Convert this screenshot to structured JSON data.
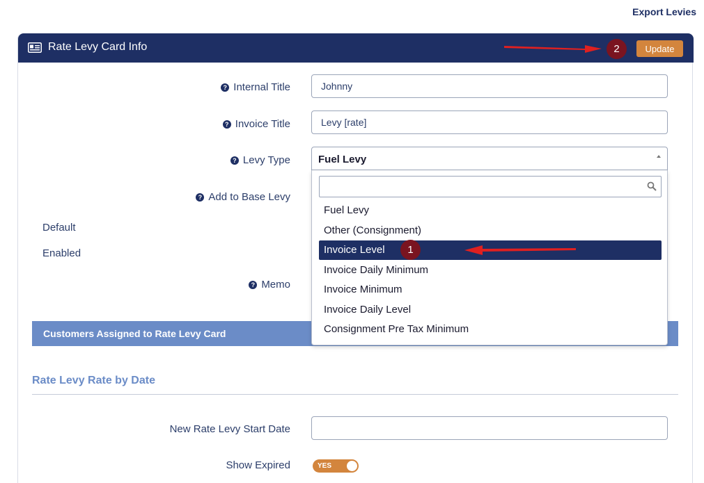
{
  "header": {
    "export_link": "Export Levies"
  },
  "card": {
    "title": "Rate Levy Card Info",
    "update_label": "Update"
  },
  "form": {
    "internal_title_label": "Internal Title",
    "internal_title_value": "Johnny",
    "invoice_title_label": "Invoice Title",
    "invoice_title_value": "Levy [rate]",
    "levy_type_label": "Levy Type",
    "levy_type_value": "Fuel Levy",
    "add_to_base_label": "Add to Base Levy",
    "default_label": "Default",
    "enabled_label": "Enabled",
    "memo_label": "Memo"
  },
  "dropdown": {
    "options": [
      "Fuel Levy",
      "Other (Consignment)",
      "Invoice Level",
      "Invoice Daily Minimum",
      "Invoice Minimum",
      "Invoice Daily Level",
      "Consignment Pre Tax Minimum"
    ],
    "selected_index": 2
  },
  "customers_section": {
    "title": "Customers Assigned to Rate Levy Card"
  },
  "rate_by_date": {
    "title": "Rate Levy Rate by Date",
    "start_date_label": "New Rate Levy Start Date",
    "start_date_value": "",
    "show_expired_label": "Show Expired",
    "show_expired_toggle": "YES"
  },
  "annotations": {
    "badge_1": "1",
    "badge_2": "2"
  },
  "colors": {
    "header": "#1e2f64",
    "accent": "#d3853d",
    "section": "#6b8cc7",
    "badge": "#7a1420",
    "arrow": "#e02020"
  }
}
